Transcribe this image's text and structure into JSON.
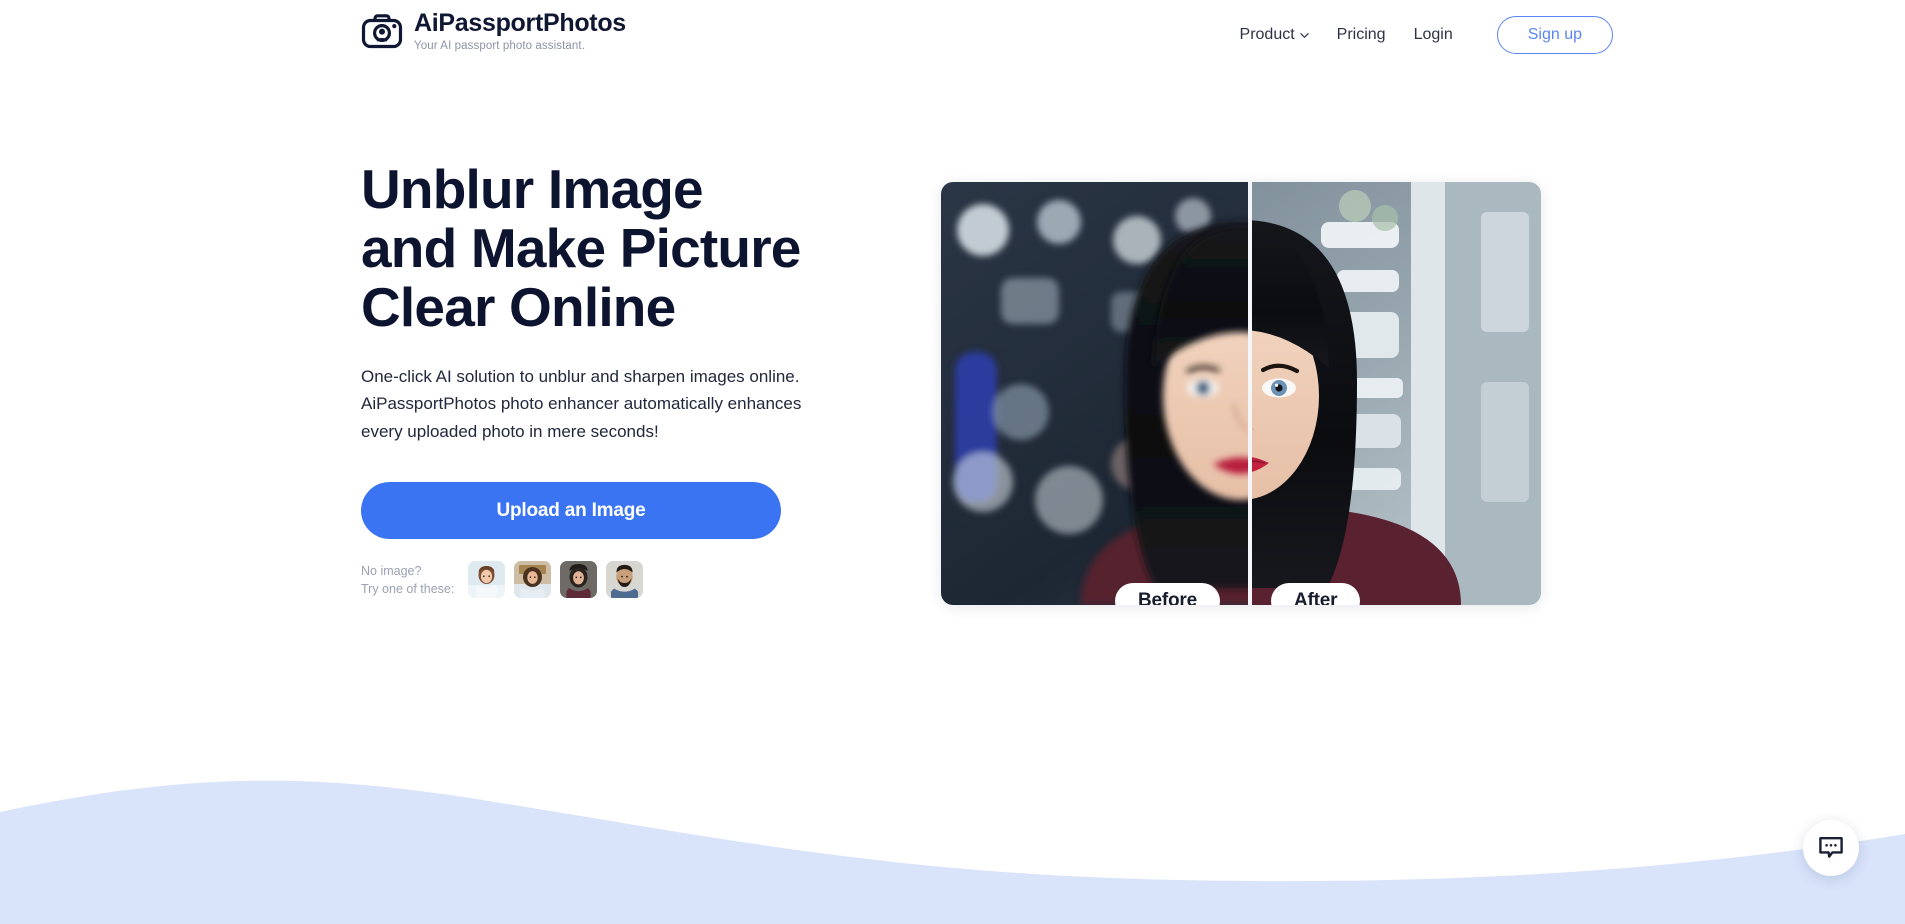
{
  "brand": {
    "name": "AiPassportPhotos",
    "tagline": "Your AI passport photo assistant.",
    "icon": "camera-icon"
  },
  "nav": {
    "product_label": "Product",
    "product_caret": "chevron-down-icon",
    "pricing_label": "Pricing",
    "login_label": "Login",
    "signup_label": "Sign up"
  },
  "hero": {
    "title_line1": "Unblur Image",
    "title_line2": "and Make Picture",
    "title_line3": "Clear Online",
    "sub_line1": "One-click AI solution to unblur and sharpen images online.",
    "sub_line2": "AiPassportPhotos photo enhancer automatically enhances",
    "sub_line3": "every uploaded photo in mere seconds!",
    "upload_label": "Upload an Image",
    "samples_line1": "No image?",
    "samples_line2": "Try one of these:",
    "thumbnails": [
      {
        "name": "sample-photo-child"
      },
      {
        "name": "sample-photo-woman-curly"
      },
      {
        "name": "sample-photo-woman-dark"
      },
      {
        "name": "sample-photo-man-beard"
      }
    ]
  },
  "comparison": {
    "before_label": "Before",
    "after_label": "After"
  },
  "chat": {
    "icon": "chat-bubble-icon"
  },
  "colors": {
    "accent_blue": "#3b74f2",
    "link_blue": "#5b86f0",
    "heading_navy": "#0d1430",
    "wave_blue": "#d7e3fb",
    "muted_gray": "#9aa1b2"
  }
}
